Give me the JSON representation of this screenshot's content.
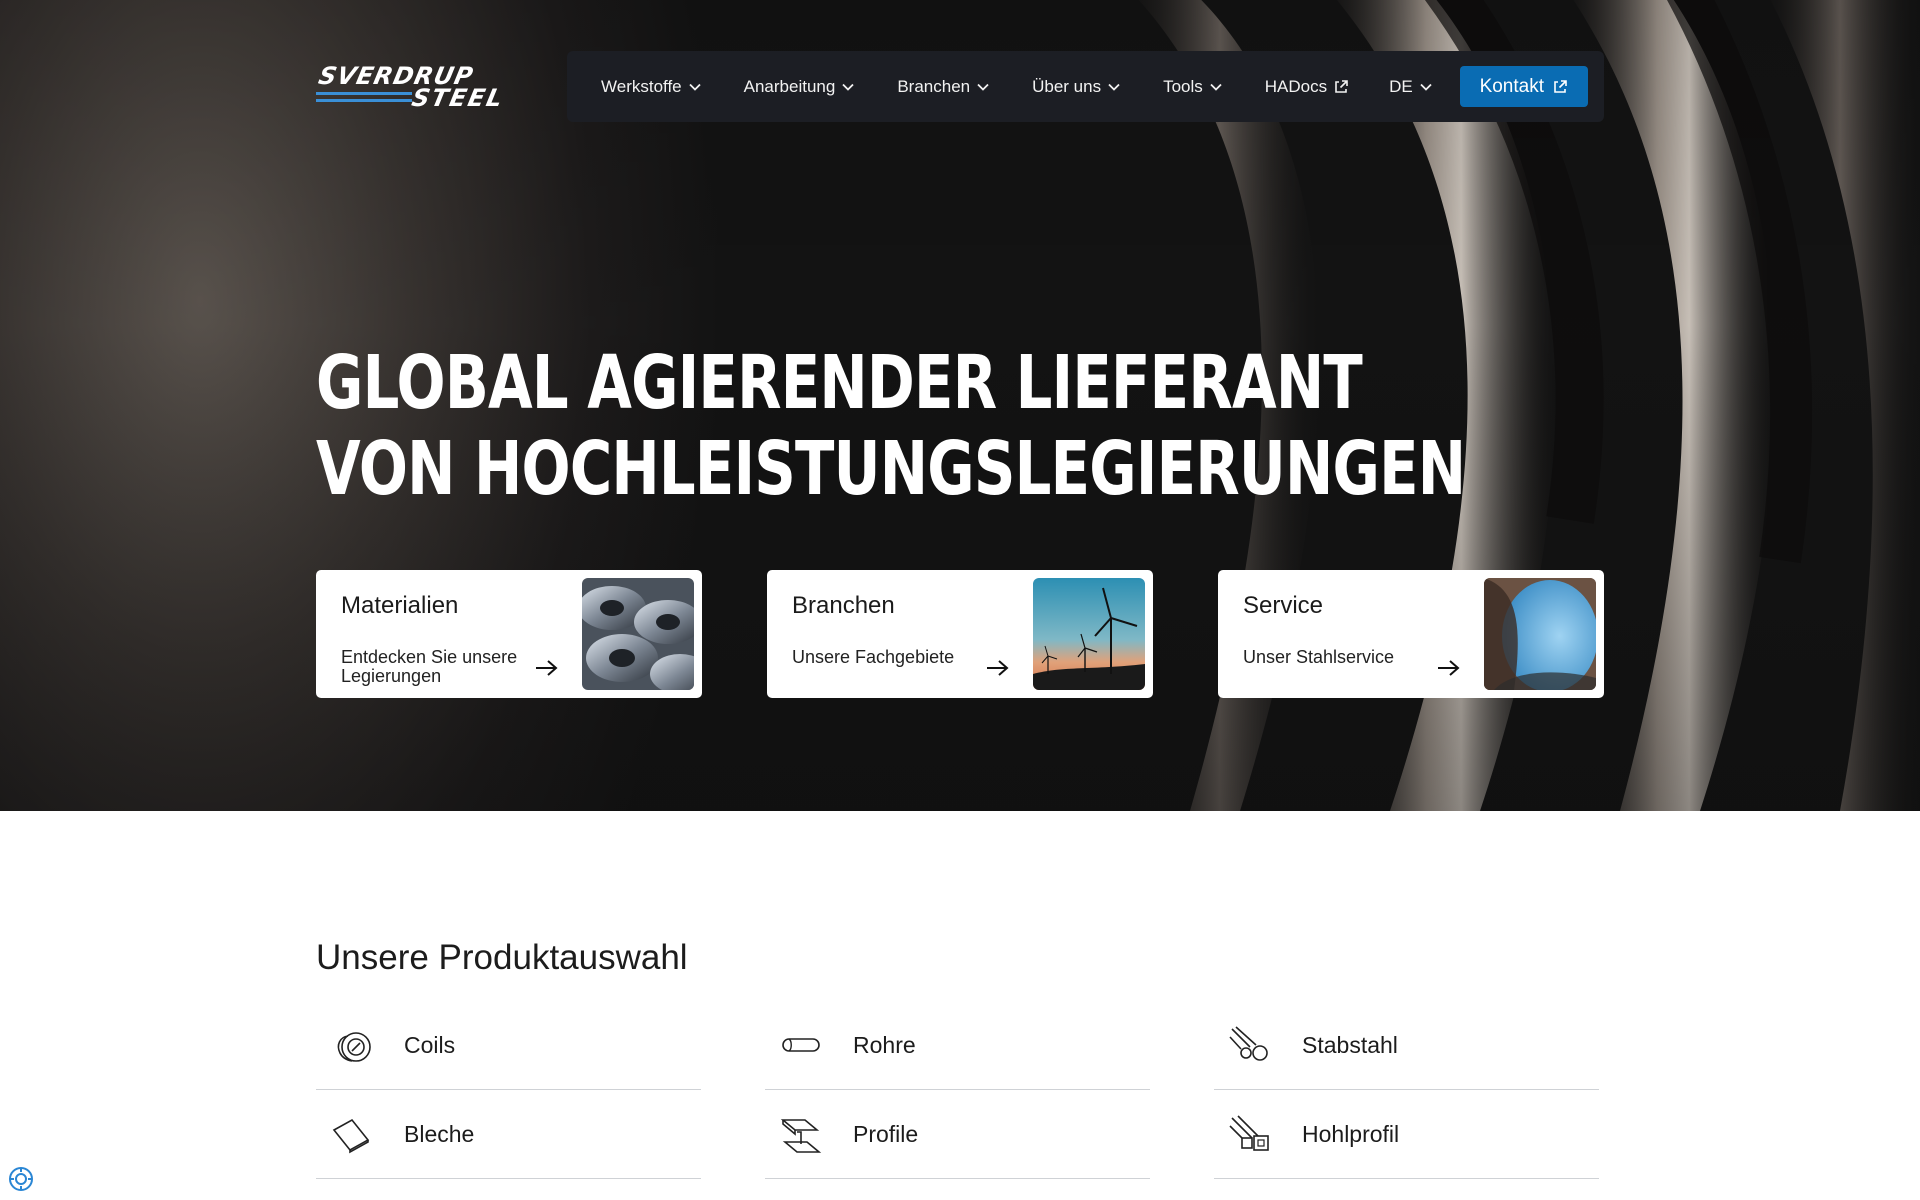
{
  "brand": {
    "logo_line1": "SVERDRUP",
    "logo_line2": "STEEL",
    "accent": "#0a6cb3"
  },
  "nav": {
    "items": [
      {
        "label": "Werkstoffe",
        "icon": "chevron-down-icon"
      },
      {
        "label": "Anarbeitung",
        "icon": "chevron-down-icon"
      },
      {
        "label": "Branchen",
        "icon": "chevron-down-icon"
      },
      {
        "label": "Über uns",
        "icon": "chevron-down-icon"
      },
      {
        "label": "Tools",
        "icon": "chevron-down-icon"
      },
      {
        "label": "HADocs",
        "icon": "external-link-icon"
      },
      {
        "label": "DE",
        "icon": "chevron-down-icon"
      }
    ],
    "cta": {
      "label": "Kontakt",
      "icon": "external-link-icon"
    }
  },
  "hero": {
    "headline_line1": "GLOBAL AGIERENDER LIEFERANT",
    "headline_line2": "VON HOCHLEISTUNGSLEGIERUNGEN",
    "cards": [
      {
        "title": "Materialien",
        "subtitle": "Entdecken Sie unsere Legierungen",
        "image": "steel-coils-image"
      },
      {
        "title": "Branchen",
        "subtitle": "Unsere Fachgebiete",
        "image": "wind-turbines-image"
      },
      {
        "title": "Service",
        "subtitle": "Unser Stahlservice",
        "image": "steel-tube-image"
      }
    ]
  },
  "products": {
    "title": "Unsere Produktauswahl",
    "items": [
      {
        "label": "Coils",
        "icon": "coil-icon"
      },
      {
        "label": "Rohre",
        "icon": "tube-icon"
      },
      {
        "label": "Stabstahl",
        "icon": "bar-steel-icon"
      },
      {
        "label": "Bleche",
        "icon": "sheet-icon"
      },
      {
        "label": "Profile",
        "icon": "profile-beam-icon"
      },
      {
        "label": "Hohlprofil",
        "icon": "hollow-profile-icon"
      }
    ]
  }
}
